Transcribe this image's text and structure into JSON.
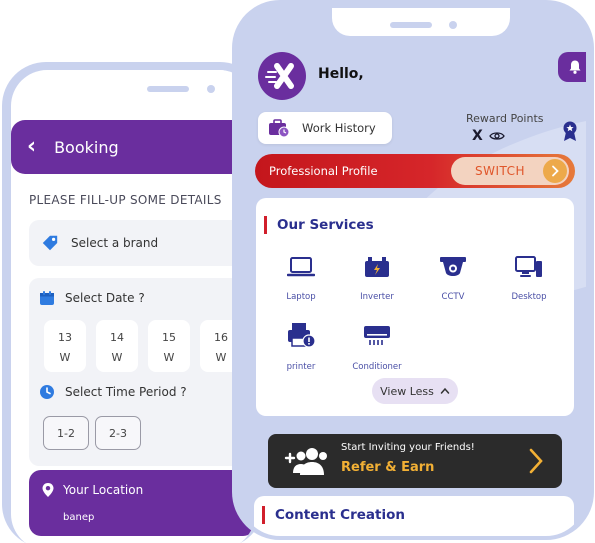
{
  "booking": {
    "header_title": "Booking",
    "fill_title": "PLEASE FILL-UP SOME DETAILS",
    "brand_label": "Select a brand",
    "date_label": "Select Date ?",
    "dates": [
      {
        "num": "13",
        "day": "W"
      },
      {
        "num": "14",
        "day": "W"
      },
      {
        "num": "15",
        "day": "W"
      },
      {
        "num": "16",
        "day": "W"
      }
    ],
    "time_label": "Select Time Period ?",
    "time_slots": [
      "1-2",
      "2-3"
    ],
    "location_label": "Your Location",
    "location_value": "banep"
  },
  "home": {
    "greeting": "Hello,",
    "avatar_letter": "X",
    "work_history_label": "Work History",
    "reward_label": "Reward Points",
    "reward_value": "X",
    "profile_label": "Professional Profile",
    "switch_label": "SWITCH",
    "services_title": "Our Services",
    "services": [
      {
        "label": "Laptop",
        "icon": "laptop-icon"
      },
      {
        "label": "Inverter",
        "icon": "inverter-icon"
      },
      {
        "label": "CCTV",
        "icon": "cctv-icon"
      },
      {
        "label": "Desktop",
        "icon": "desktop-icon"
      },
      {
        "label": "printer",
        "icon": "printer-icon"
      },
      {
        "label": "Conditioner",
        "icon": "air-conditioner-icon"
      }
    ],
    "view_less_label": "View Less",
    "refer_top": "Start Inviting your Friends!",
    "refer_main": "Refer & Earn",
    "content_title": "Content Creation"
  },
  "colors": {
    "primary_purple": "#6a2e9e",
    "accent_red": "#d11f2b",
    "refer_yellow": "#f2b035",
    "service_blue": "#2a2f8e"
  }
}
